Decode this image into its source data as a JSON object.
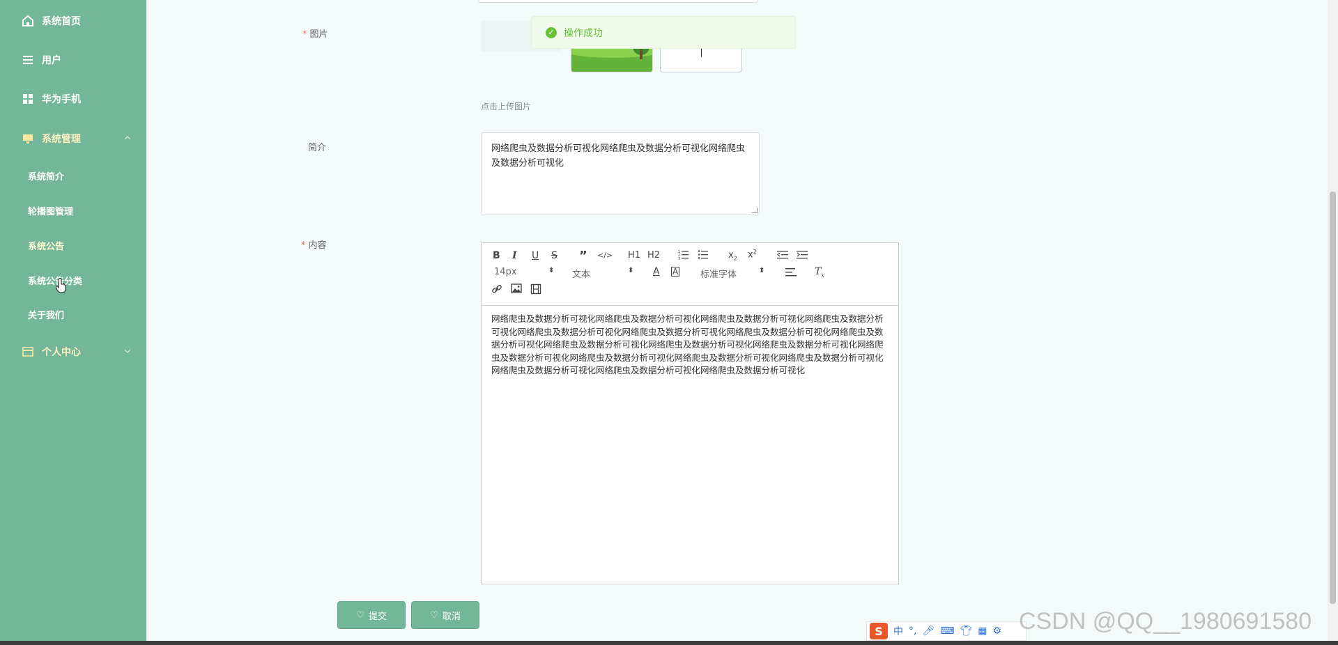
{
  "sidebar": {
    "items": [
      {
        "label": "系统首页",
        "icon": "home-icon"
      },
      {
        "label": "用户",
        "icon": "list-icon"
      },
      {
        "label": "华为手机",
        "icon": "grid-icon"
      },
      {
        "label": "系统管理",
        "icon": "monitor-icon",
        "expanded": true
      },
      {
        "label": "个人中心",
        "icon": "card-icon",
        "expanded": false
      }
    ],
    "sub_items": [
      "系统简介",
      "轮播图管理",
      "系统公告",
      "系统公告分类",
      "关于我们"
    ]
  },
  "form": {
    "image_label": "图片",
    "upload_hint": "点击上传图片",
    "intro_label": "简介",
    "intro_value": "网络爬虫及数据分析可视化网络爬虫及数据分析可视化网络爬虫及数据分析可视化",
    "content_label": "内容",
    "content_value": "网络爬虫及数据分析可视化网络爬虫及数据分析可视化网络爬虫及数据分析可视化网络爬虫及数据分析可视化网络爬虫及数据分析可视化网络爬虫及数据分析可视化网络爬虫及数据分析可视化网络爬虫及数据分析可视化网络爬虫及数据分析可视化网络爬虫及数据分析可视化网络爬虫及数据分析可视化网络爬虫及数据分析可视化网络爬虫及数据分析可视化网络爬虫及数据分析可视化网络爬虫及数据分析可视化网络爬虫及数据分析可视化网络爬虫及数据分析可视化网络爬虫及数据分析可视化",
    "submit_label": "提交",
    "cancel_label": "取消"
  },
  "editor": {
    "font_size": "14px",
    "text_type": "文本",
    "font_family": "标准字体",
    "h1": "H1",
    "h2": "H2"
  },
  "toast": {
    "message": "操作成功"
  },
  "ime": {
    "lang": "中"
  },
  "watermark": "CSDN @QQ__1980691580",
  "colors": {
    "sidebar": "#73b69a",
    "background": "#f4f9f9",
    "success": "#67c23a",
    "required": "#f56c6c"
  }
}
